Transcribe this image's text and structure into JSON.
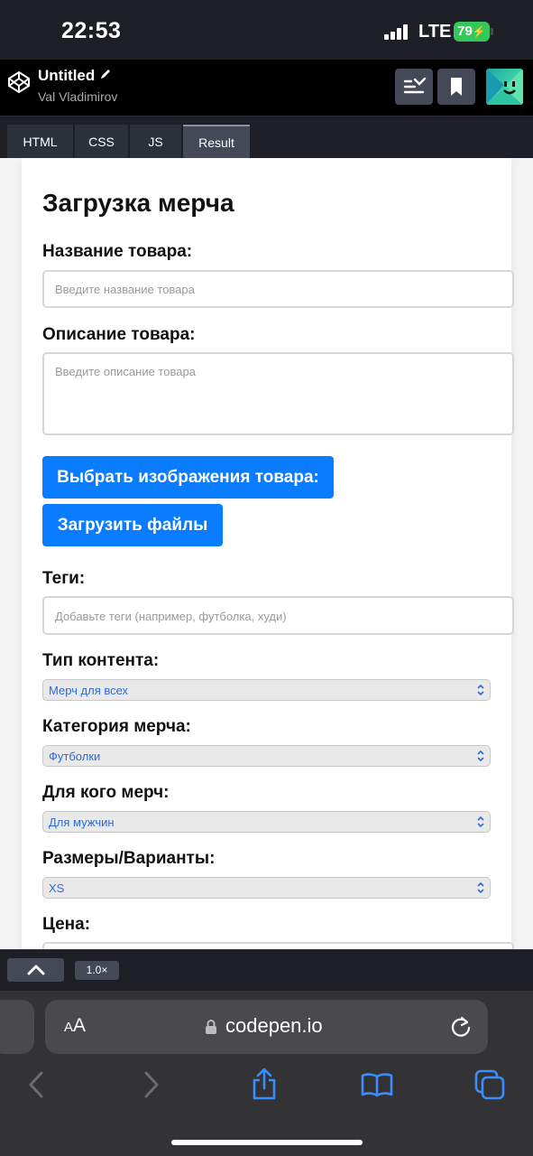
{
  "status": {
    "time": "22:53",
    "network": "LTE",
    "battery": "79"
  },
  "pen": {
    "title": "Untitled",
    "author": "Val Vladimirov"
  },
  "tabs": [
    {
      "label": "HTML"
    },
    {
      "label": "CSS"
    },
    {
      "label": "JS"
    },
    {
      "label": "Result",
      "active": true
    }
  ],
  "form": {
    "title": "Загрузка мерча",
    "name_label": "Название товара:",
    "name_placeholder": "Введите название товара",
    "desc_label": "Описание товара:",
    "desc_placeholder": "Введите описание товара",
    "choose_images_button": "Выбрать изображения товара:",
    "upload_files_button": "Загрузить файлы",
    "tags_label": "Теги:",
    "tags_placeholder": "Добавьте теги (например, футболка, худи)",
    "content_type_label": "Тип контента:",
    "content_type_value": "Мерч для всех",
    "category_label": "Категория мерча:",
    "category_value": "Футболки",
    "audience_label": "Для кого мерч:",
    "audience_value": "Для мужчин",
    "sizes_label": "Размеры/Варианты:",
    "sizes_value": "XS",
    "price_label": "Цена:"
  },
  "bottom_bar": {
    "zoom": "1.0×"
  },
  "browser": {
    "text_size": "AA",
    "url": "codepen.io"
  },
  "colors": {
    "accent": "#0a7cff",
    "battery": "#34c759"
  }
}
